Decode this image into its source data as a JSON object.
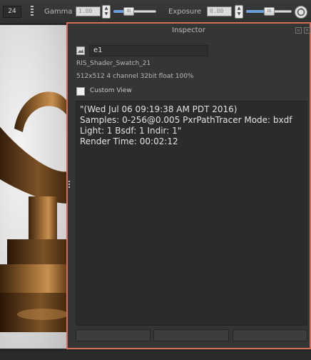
{
  "toolbar": {
    "frame_value": "24",
    "gamma_label": "Gamma",
    "gamma_value": "1.00",
    "exposure_label": "Exposure",
    "exposure_value": "0.00",
    "gamma_slider_level": 0.3,
    "exposure_slider_level": 0.5,
    "slider_thumb_glyph": "III",
    "spin_up": "▲",
    "spin_down": "▼",
    "end_icon": "refresh-icon"
  },
  "inspector": {
    "title": "Inspector",
    "image_name": "e1",
    "shader_name": "RIS_Shader_Swatch_21",
    "image_info": "512x512 4 channel 32bit float 100%",
    "custom_view_label": "Custom View",
    "custom_view_checked": false,
    "info_lines": [
      "\"(Wed Jul 06 09:19:38 AM PDT 2016)",
      "Samples: 0-256@0.005  PxrPathTracer  Mode: bxdf",
      "Light: 1  Bsdf: 1  Indir: 1\"",
      "Render Time: 00:02:12"
    ],
    "accent_color": "#d96a55",
    "title_buttons": [
      "float-icon",
      "close-icon"
    ]
  },
  "viewport": {
    "subject": "bronze trophy render"
  }
}
